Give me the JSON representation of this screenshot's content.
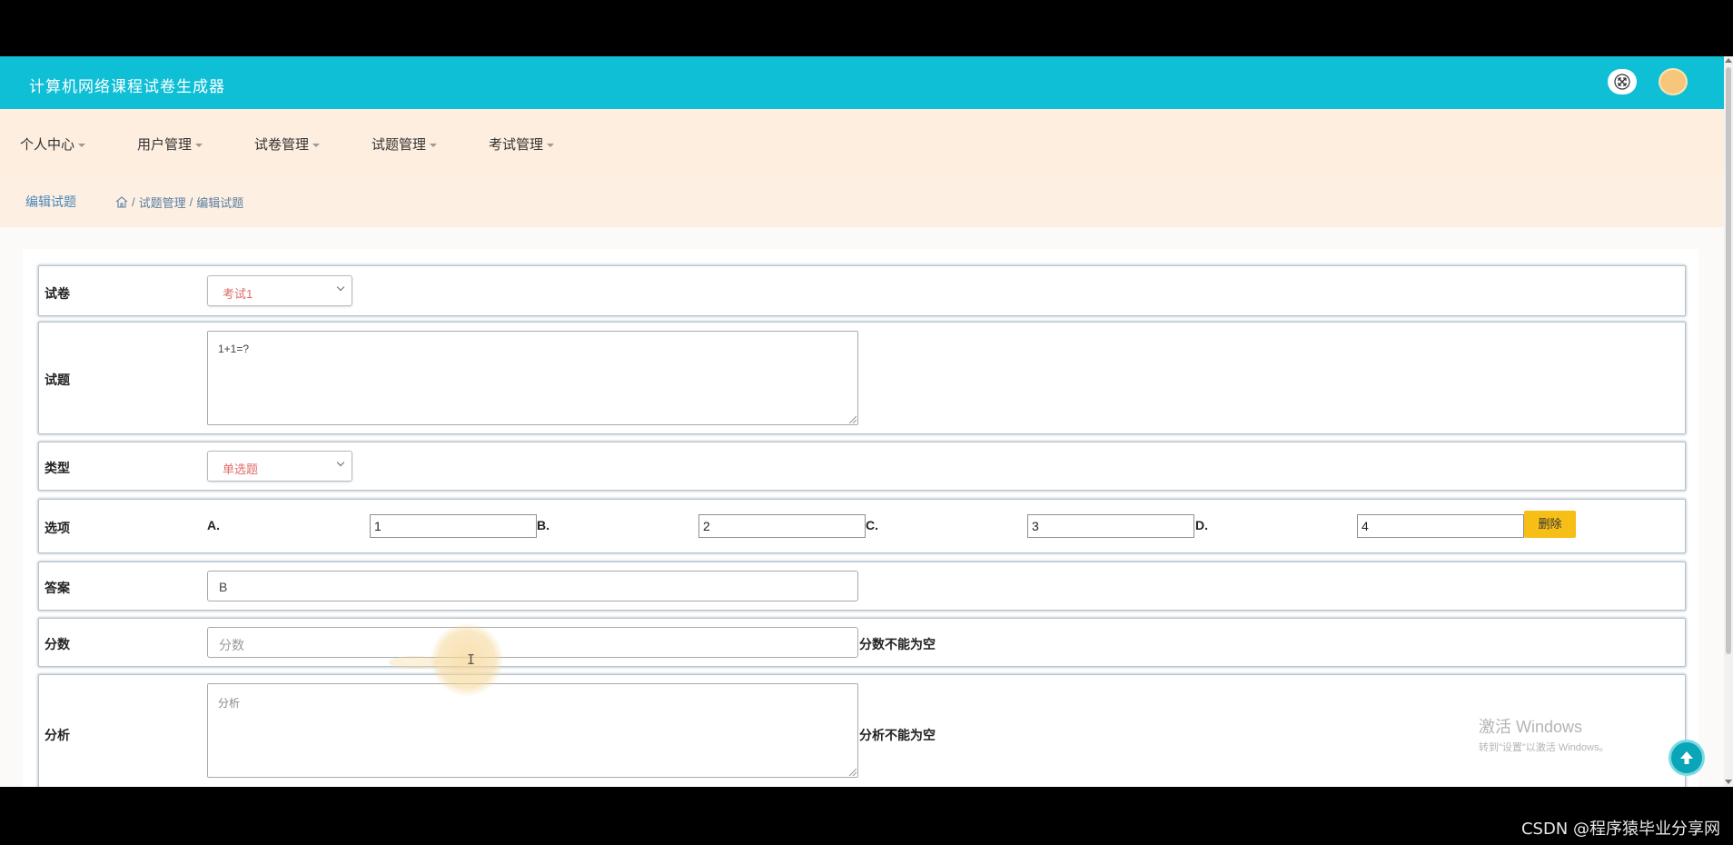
{
  "app": {
    "title": "计算机网络课程试卷生成器"
  },
  "nav": [
    {
      "label": "个人中心"
    },
    {
      "label": "用户管理"
    },
    {
      "label": "试卷管理"
    },
    {
      "label": "试题管理"
    },
    {
      "label": "考试管理"
    }
  ],
  "breadcrumb": {
    "page_title": "编辑试题",
    "items": [
      "试题管理",
      "编辑试题"
    ],
    "separator": "/"
  },
  "form": {
    "paper": {
      "label": "试卷",
      "value": "考试1"
    },
    "question": {
      "label": "试题",
      "value": "1+1=?"
    },
    "type": {
      "label": "类型",
      "value": "单选题"
    },
    "options": {
      "label": "选项",
      "items": [
        {
          "letter": "A.",
          "value": "1"
        },
        {
          "letter": "B.",
          "value": "2"
        },
        {
          "letter": "C.",
          "value": "3"
        },
        {
          "letter": "D.",
          "value": "4"
        }
      ],
      "delete_label": "删除"
    },
    "answer": {
      "label": "答案",
      "value": "B"
    },
    "score": {
      "label": "分数",
      "placeholder": "分数",
      "error": "分数不能为空"
    },
    "analysis": {
      "label": "分析",
      "placeholder": "分析",
      "error": "分析不能为空"
    }
  },
  "system": {
    "activate_title": "激活 Windows",
    "activate_sub": "转到\"设置\"以激活 Windows。"
  },
  "watermark": "CSDN @程序猿毕业分享网",
  "colors": {
    "header": "#0fbfd6",
    "navbar": "#fdeedf",
    "delete_button": "#f7be16",
    "select_text": "#e06b6b"
  },
  "icons": [
    "fullscreen-icon",
    "avatar-icon",
    "home-icon",
    "arrow-up-icon",
    "chevron-down-icon"
  ]
}
